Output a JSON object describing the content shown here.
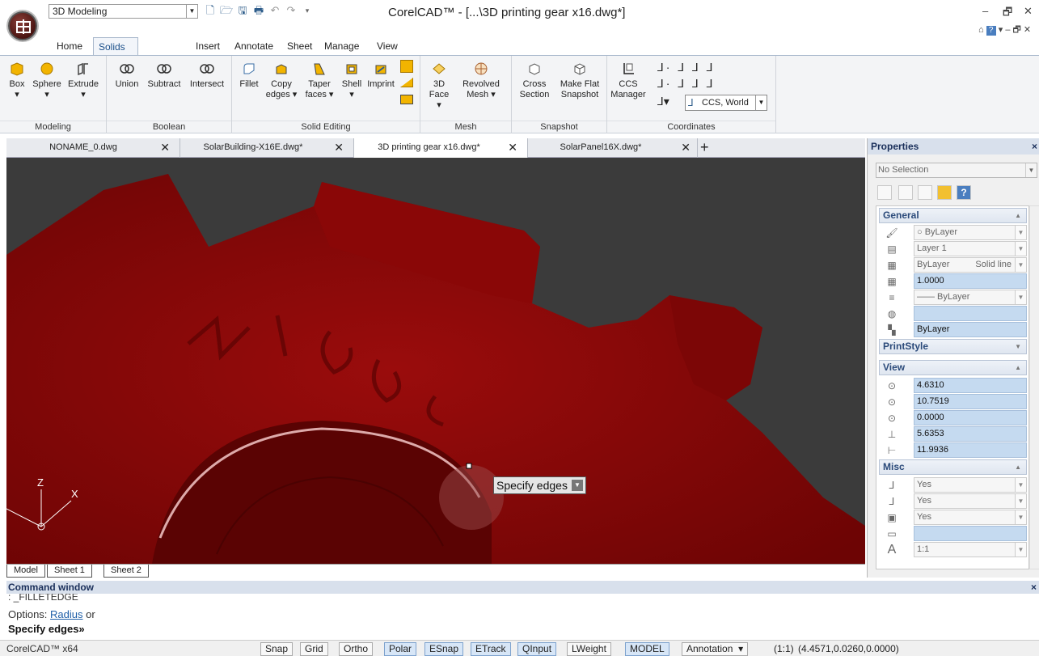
{
  "titlebar": {
    "workspace": "3D Modeling",
    "title": "CorelCAD™ - [...\\3D printing gear x16.dwg*]",
    "min": "–",
    "restore": "🗗",
    "close": "✕"
  },
  "ribbon_tabs": [
    "Home",
    "Solids and Meshes",
    "Insert",
    "Annotate",
    "Sheet",
    "Manage",
    "View"
  ],
  "ribbon": {
    "modeling": {
      "label": "Modeling",
      "box": "Box",
      "sphere": "Sphere",
      "extrude": "Extrude"
    },
    "boolean": {
      "label": "Boolean",
      "union": "Union",
      "subtract": "Subtract",
      "intersect": "Intersect"
    },
    "solid_editing": {
      "label": "Solid Editing",
      "fillet": "Fillet",
      "copy": "Copy",
      "copy2": "edges ▾",
      "taper": "Taper",
      "taper2": "faces ▾",
      "shell": "Shell",
      "imprint": "Imprint"
    },
    "mesh": {
      "label": "Mesh",
      "face3d": "3D",
      "face3d2": "Face ▾",
      "revolved": "Revolved",
      "revolved2": "Mesh ▾"
    },
    "snapshot": {
      "label": "Snapshot",
      "cross": "Cross",
      "cross2": "Section",
      "makeflat": "Make Flat",
      "makeflat2": "Snapshot"
    },
    "coordinates": {
      "label": "Coordinates",
      "ccs": "CCS",
      "ccs2": "Manager",
      "combo": "CCS, World"
    }
  },
  "doc_tabs": [
    {
      "name": "NONAME_0.dwg",
      "close": "✕"
    },
    {
      "name": "SolarBuilding-X16E.dwg*",
      "close": "✕"
    },
    {
      "name": "3D printing gear x16.dwg*",
      "close": "✕"
    },
    {
      "name": "SolarPanel16X.dwg*",
      "close": "✕"
    }
  ],
  "add_tab": "+",
  "viewport": {
    "tooltip": "Specify edges",
    "axis_x": "X",
    "axis_z": "Z",
    "model_color": "#8b0000"
  },
  "sheet_tabs": [
    "Model",
    "Sheet 1",
    "Sheet 2"
  ],
  "properties": {
    "title": "Properties",
    "close": "×",
    "selection": "No Selection",
    "general": {
      "label": "General",
      "color": "ByLayer",
      "layer": "Layer 1",
      "linetype": "ByLayer",
      "linetype_style": "Solid line",
      "scale": "1.0000",
      "lineweight": "—— ByLayer",
      "plotstyle_empty": "",
      "transparency": "ByLayer"
    },
    "printstyle": {
      "label": "PrintStyle"
    },
    "view": {
      "label": "View",
      "cx": "4.6310",
      "cy": "10.7519",
      "cz": "0.0000",
      "height": "5.6353",
      "width": "11.9936"
    },
    "misc": {
      "label": "Misc",
      "v1": "Yes",
      "v2": "Yes",
      "v3": "Yes",
      "v4": "",
      "scale": "1:1"
    }
  },
  "command": {
    "title": "Command window",
    "close": "×",
    "prev": ": _FILLETEDGE",
    "options_prefix": "Options: ",
    "options_link": "Radius",
    "options_suffix": " or",
    "prompt": "Specify edges»"
  },
  "status": {
    "app": "CorelCAD™ x64",
    "buttons": [
      "Snap",
      "Grid",
      "Ortho",
      "Polar",
      "ESnap",
      "ETrack",
      "QInput",
      "LWeight",
      "MODEL"
    ],
    "annotation": "Annotation",
    "annotation_dd": "▾",
    "scale": "(1:1)",
    "coords": "(4.4571,0.0260,0.0000)"
  }
}
